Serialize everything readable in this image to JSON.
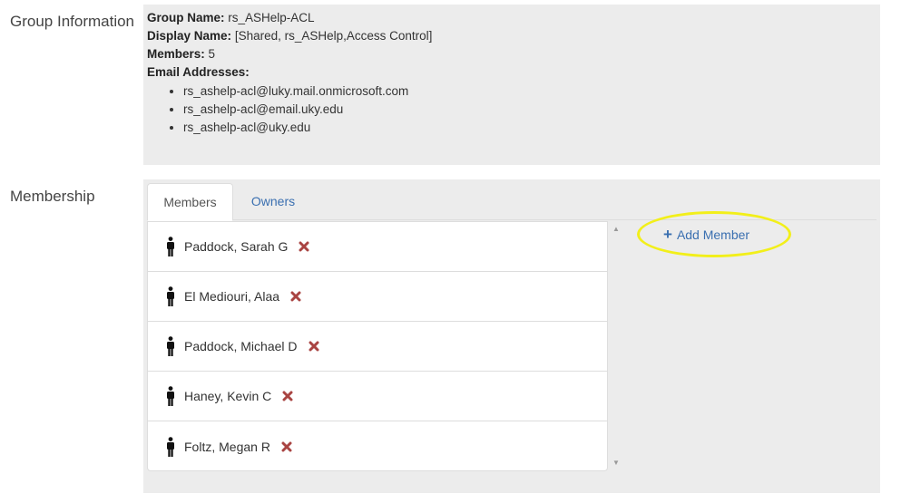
{
  "group_info": {
    "label": "Group Information",
    "group_name_label": "Group Name:",
    "group_name": "rs_ASHelp-ACL",
    "display_name_label": "Display Name:",
    "display_name": "[Shared, rs_ASHelp,Access Control]",
    "members_label": "Members:",
    "members_count": "5",
    "email_label": "Email Addresses:",
    "emails": [
      "rs_ashelp-acl@luky.mail.onmicrosoft.com",
      "rs_ashelp-acl@email.uky.edu",
      "rs_ashelp-acl@uky.edu"
    ]
  },
  "membership": {
    "label": "Membership",
    "tabs": [
      {
        "label": "Members",
        "active": true
      },
      {
        "label": "Owners",
        "active": false
      }
    ],
    "members": [
      {
        "name": "Paddock, Sarah G",
        "icon": "person-icon"
      },
      {
        "name": "El Mediouri, Alaa",
        "icon": "person-icon"
      },
      {
        "name": "Paddock, Michael D",
        "icon": "person-icon"
      },
      {
        "name": "Haney, Kevin C",
        "icon": "person-icon"
      },
      {
        "name": "Foltz, Megan R",
        "icon": "person-icon"
      }
    ],
    "add_member_label": "Add Member",
    "add_member_icon": "plus-icon",
    "remove_icon": "remove-x-icon"
  },
  "colors": {
    "panel_bg": "#ececec",
    "link": "#3a6fb0",
    "remove": "#a94442",
    "highlight": "#f2ef1a"
  }
}
